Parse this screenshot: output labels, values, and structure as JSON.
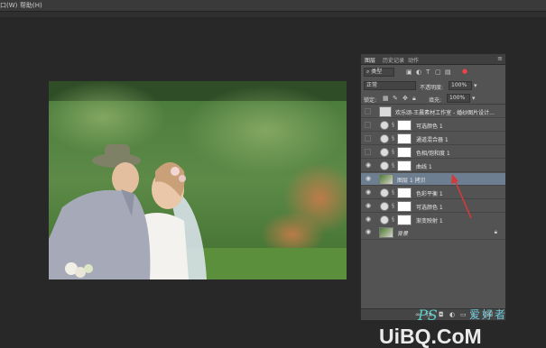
{
  "menubar": {
    "items": [
      "口(W)",
      "帮助(H)"
    ]
  },
  "layers_panel": {
    "tabs": [
      "图层",
      "历史记录",
      "动作"
    ],
    "kind_label": "类型",
    "blend_mode": "正常",
    "opacity_label": "不透明度:",
    "opacity_value": "100%",
    "lock_label": "锁定:",
    "fill_label": "填充:",
    "fill_value": "100%",
    "layers": [
      {
        "name": "欢乐颂-王晨素材工作室 - 婚纱图片设计...",
        "type": "text",
        "visible": false,
        "selected": false
      },
      {
        "name": "可选颜色 1",
        "type": "adjustment",
        "visible": false,
        "selected": false
      },
      {
        "name": "通道混合器 1",
        "type": "adjustment",
        "visible": false,
        "selected": false
      },
      {
        "name": "色相/饱和度 1",
        "type": "adjustment",
        "visible": false,
        "selected": false
      },
      {
        "name": "曲线 1",
        "type": "adjustment",
        "visible": true,
        "selected": false
      },
      {
        "name": "图层 1 拷贝",
        "type": "pixel",
        "visible": true,
        "selected": true
      },
      {
        "name": "色彩平衡 1",
        "type": "adjustment",
        "visible": true,
        "selected": false
      },
      {
        "name": "可选颜色 1",
        "type": "adjustment",
        "visible": true,
        "selected": false
      },
      {
        "name": "渐变映射 1",
        "type": "adjustment",
        "visible": true,
        "selected": false
      },
      {
        "name": "背景",
        "type": "background",
        "visible": true,
        "selected": false,
        "locked": true
      }
    ]
  },
  "watermark": {
    "ps": "PS",
    "cn": "爱好者",
    "url": "UiBQ.CoM"
  },
  "colors": {
    "workspace": "#282828",
    "panel": "#535353",
    "selected_layer": "#6d7e91",
    "annotation_arrow": "#d23b3b"
  }
}
